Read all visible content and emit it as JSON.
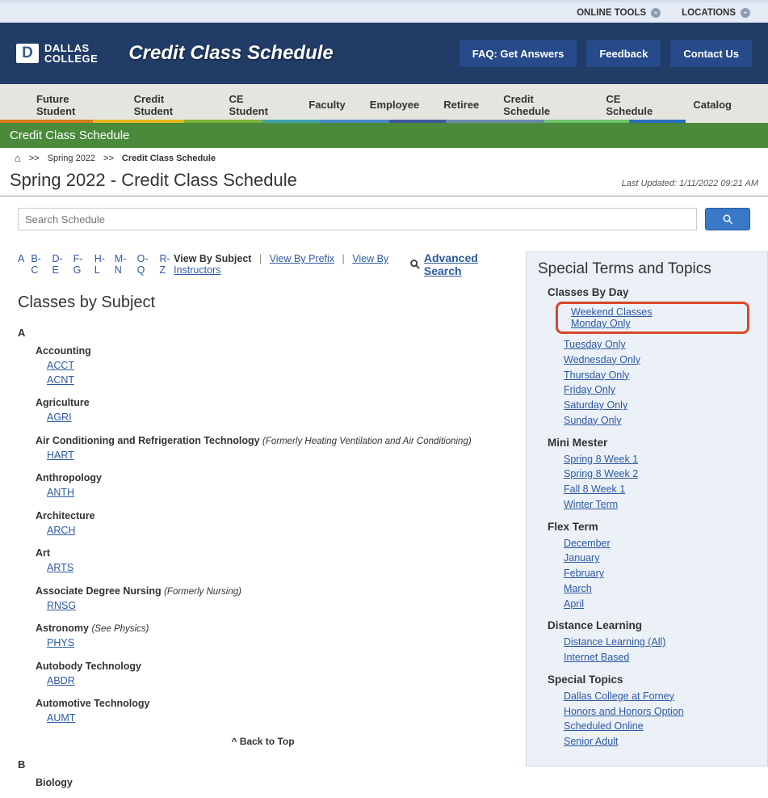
{
  "utility": {
    "online_tools": "ONLINE TOOLS",
    "locations": "LOCATIONS"
  },
  "logo": {
    "line1": "DALLAS",
    "line2": "COLLEGE"
  },
  "banner": {
    "title": "Credit Class Schedule",
    "faq": "FAQ: Get Answers",
    "feedback": "Feedback",
    "contact": "Contact Us"
  },
  "nav": {
    "items": [
      "Future Student",
      "Credit Student",
      "CE Student",
      "Faculty",
      "Employee",
      "Retiree",
      "Credit Schedule",
      "CE Schedule",
      "Catalog"
    ]
  },
  "section_bar": "Credit Class Schedule",
  "breadcrumb": {
    "term": "Spring 2022",
    "current": "Credit Class Schedule"
  },
  "page": {
    "title": "Spring 2022 - Credit Class Schedule",
    "last_updated": "Last Updated: 1/11/2022 09:21 AM"
  },
  "search": {
    "placeholder": "Search Schedule"
  },
  "alpha": [
    "A",
    "B-C",
    "D-E",
    "F-G",
    "H-L",
    "M-N",
    "O-Q",
    "R-Z"
  ],
  "viewby": {
    "subject": "View By Subject",
    "prefix": "View By Prefix",
    "instructors": "View By Instructors",
    "advanced": "Advanced Search"
  },
  "subjects": {
    "heading": "Classes by Subject",
    "groups": [
      {
        "letter": "A",
        "items": [
          {
            "name": "Accounting",
            "note": "",
            "codes": [
              "ACCT",
              "ACNT"
            ]
          },
          {
            "name": "Agriculture",
            "note": "",
            "codes": [
              "AGRI"
            ]
          },
          {
            "name": "Air Conditioning and Refrigeration Technology",
            "note": "(Formerly Heating Ventilation and Air Conditioning)",
            "codes": [
              "HART"
            ]
          },
          {
            "name": "Anthropology",
            "note": "",
            "codes": [
              "ANTH"
            ]
          },
          {
            "name": "Architecture",
            "note": "",
            "codes": [
              "ARCH"
            ]
          },
          {
            "name": "Art",
            "note": "",
            "codes": [
              "ARTS"
            ]
          },
          {
            "name": "Associate Degree Nursing",
            "note": "(Formerly Nursing)",
            "codes": [
              "RNSG"
            ]
          },
          {
            "name": "Astronomy",
            "note": "(See Physics)",
            "codes": [
              "PHYS"
            ]
          },
          {
            "name": "Autobody Technology",
            "note": "",
            "codes": [
              "ABDR"
            ]
          },
          {
            "name": "Automotive Technology",
            "note": "",
            "codes": [
              "AUMT"
            ]
          }
        ]
      },
      {
        "letter": "B",
        "items": [
          {
            "name": "Biology",
            "note": "",
            "codes": []
          }
        ]
      }
    ],
    "back_to_top": "^ Back to Top"
  },
  "sidebar": {
    "title": "Special Terms and Topics",
    "groups": [
      {
        "title": "Classes By Day",
        "highlight": [
          "Weekend Classes",
          "Monday Only"
        ],
        "links": [
          "Tuesday Only",
          "Wednesday Only",
          "Thursday Only",
          "Friday Only",
          "Saturday Only",
          "Sunday Only"
        ]
      },
      {
        "title": "Mini Mester",
        "links": [
          "Spring 8 Week 1",
          "Spring 8 Week 2",
          "Fall 8 Week 1",
          "Winter Term"
        ]
      },
      {
        "title": "Flex Term",
        "links": [
          "December",
          "January",
          "February",
          "March",
          "April"
        ]
      },
      {
        "title": "Distance Learning",
        "links": [
          "Distance Learning (All)",
          "Internet Based"
        ]
      },
      {
        "title": "Special Topics",
        "links": [
          "Dallas College at Forney",
          "Honors and Honors Option",
          "Scheduled Online",
          "Senior Adult"
        ]
      }
    ]
  }
}
